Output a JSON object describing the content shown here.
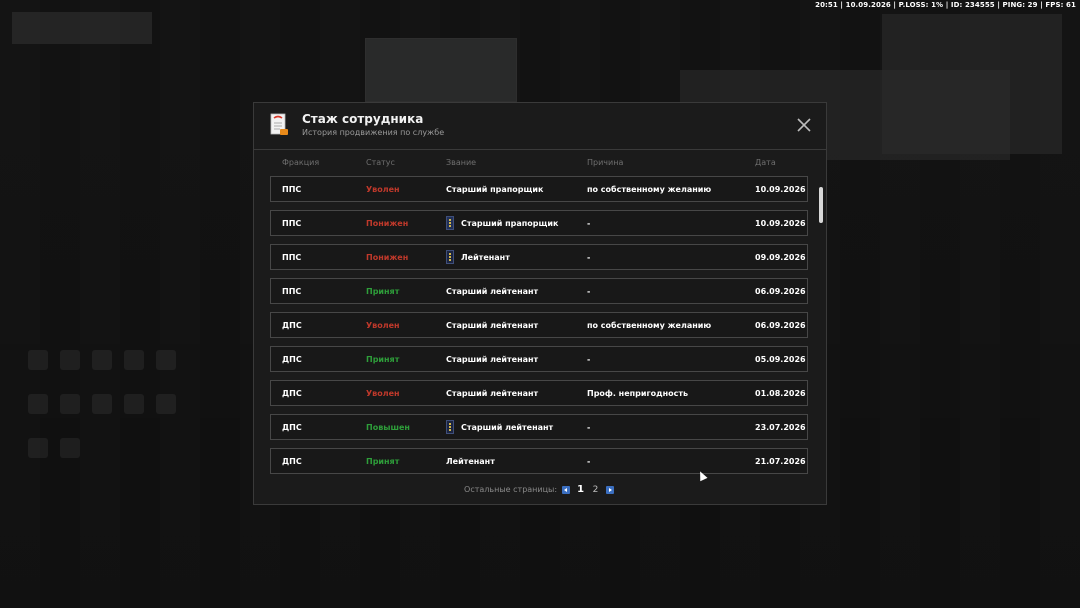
{
  "hud": {
    "status_line": "20:51 | 10.09.2026 | P.LOSS: 1% | ID: 234555 | PING: 29 | FPS: 61"
  },
  "modal": {
    "title": "Стаж сотрудника",
    "subtitle": "История продвижения по службе",
    "icon": "document-icon",
    "close_icon": "close-icon"
  },
  "table": {
    "headers": {
      "faction": "Фракция",
      "status": "Статус",
      "rank": "Звание",
      "reason": "Причина",
      "date": "Дата"
    },
    "rows": [
      {
        "faction": "ППС",
        "status": "Уволен",
        "status_color": "#c0392b",
        "rank": "Старший прапорщик",
        "badge": false,
        "reason": "по собственному желанию",
        "date": "10.09.2026"
      },
      {
        "faction": "ППС",
        "status": "Понижен",
        "status_color": "#c0392b",
        "rank": "Старший прапорщик",
        "badge": true,
        "reason": "-",
        "date": "10.09.2026"
      },
      {
        "faction": "ППС",
        "status": "Понижен",
        "status_color": "#c0392b",
        "rank": "Лейтенант",
        "badge": true,
        "reason": "-",
        "date": "09.09.2026"
      },
      {
        "faction": "ППС",
        "status": "Принят",
        "status_color": "#2e9e3a",
        "rank": "Старший лейтенант",
        "badge": false,
        "reason": "-",
        "date": "06.09.2026"
      },
      {
        "faction": "ДПС",
        "status": "Уволен",
        "status_color": "#c0392b",
        "rank": "Старший лейтенант",
        "badge": false,
        "reason": "по собственному желанию",
        "date": "06.09.2026"
      },
      {
        "faction": "ДПС",
        "status": "Принят",
        "status_color": "#2e9e3a",
        "rank": "Старший лейтенант",
        "badge": false,
        "reason": "-",
        "date": "05.09.2026"
      },
      {
        "faction": "ДПС",
        "status": "Уволен",
        "status_color": "#c0392b",
        "rank": "Старший лейтенант",
        "badge": false,
        "reason": "Проф. непригодность",
        "date": "01.08.2026"
      },
      {
        "faction": "ДПС",
        "status": "Повышен",
        "status_color": "#2e9e3a",
        "rank": "Старший лейтенант",
        "badge": true,
        "reason": "-",
        "date": "23.07.2026"
      },
      {
        "faction": "ДПС",
        "status": "Принят",
        "status_color": "#2e9e3a",
        "rank": "Лейтенант",
        "badge": false,
        "reason": "-",
        "date": "21.07.2026"
      }
    ]
  },
  "pagination": {
    "label": "Остальные страницы:",
    "pages": [
      "1",
      "2"
    ],
    "current": "1",
    "prev_icon": "chevron-left-icon",
    "next_icon": "chevron-right-icon"
  }
}
